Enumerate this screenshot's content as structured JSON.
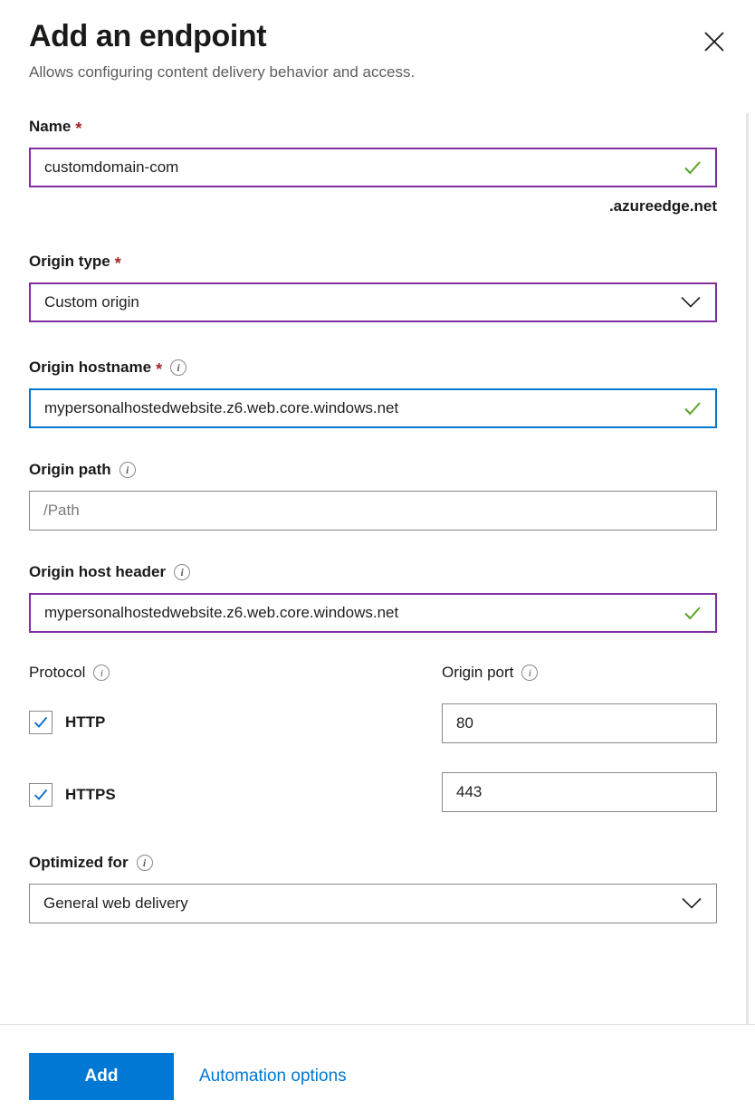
{
  "header": {
    "title": "Add an endpoint",
    "subtitle": "Allows configuring content delivery behavior and access.",
    "close_label": "Close"
  },
  "colors": {
    "accent": "#0078d4",
    "validated_border": "#7f2f9e",
    "focus_border": "#0078d4",
    "required_asterisk": "#a4262c",
    "success_check": "#5ea226",
    "link": "#0078d4"
  },
  "form": {
    "name": {
      "label": "Name",
      "required_marker": "*",
      "value": "customdomain-com",
      "placeholder": "",
      "suffix": ".azureedge.net",
      "state": "validated"
    },
    "origin_type": {
      "label": "Origin type",
      "required_marker": "*",
      "value": "Custom origin",
      "options": [
        "Custom origin"
      ],
      "state": "validated"
    },
    "origin_hostname": {
      "label": "Origin hostname",
      "required_marker": "*",
      "info": "info-icon",
      "value": "mypersonalhostedwebsite.z6.web.core.windows.net",
      "placeholder": "",
      "state": "focused"
    },
    "origin_path": {
      "label": "Origin path",
      "info": "info-icon",
      "value": "",
      "placeholder": "/Path",
      "state": "default"
    },
    "origin_host_header": {
      "label": "Origin host header",
      "info": "info-icon",
      "value": "mypersonalhostedwebsite.z6.web.core.windows.net",
      "placeholder": "",
      "state": "validated"
    },
    "protocol": {
      "label": "Protocol",
      "info": "info-icon",
      "items": [
        {
          "label": "HTTP",
          "checked": true
        },
        {
          "label": "HTTPS",
          "checked": true
        }
      ]
    },
    "origin_port": {
      "label": "Origin port",
      "info": "info-icon",
      "items": [
        {
          "value": "80"
        },
        {
          "value": "443"
        }
      ]
    },
    "optimized_for": {
      "label": "Optimized for",
      "info": "info-icon",
      "value": "General web delivery",
      "options": [
        "General web delivery"
      ],
      "state": "default"
    }
  },
  "footer": {
    "add_label": "Add",
    "automation_label": "Automation options"
  }
}
